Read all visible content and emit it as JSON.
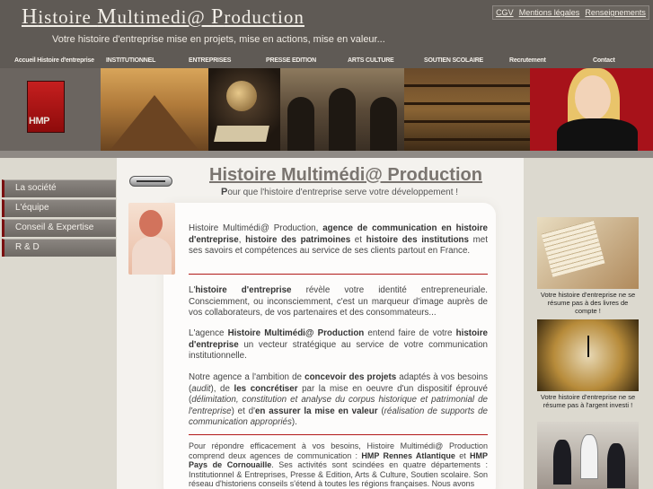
{
  "header": {
    "title_parts": [
      "H",
      "istoire ",
      "M",
      "ultimedi@ ",
      "P",
      "roduction"
    ],
    "tagline": "Votre histoire d'entreprise mise en projets, mise en actions, mise en valeur...",
    "links": [
      "CGV",
      "Mentions légales",
      "Renseignements"
    ]
  },
  "nav": {
    "items": [
      "Accueil Histoire d'entreprise",
      "INSTITUTIONNEL",
      "ENTREPRISES",
      "PRESSE EDITION",
      "ARTS CULTURE",
      "SOUTIEN SCOLAIRE",
      "Recrutement",
      "Contact"
    ]
  },
  "logo": {
    "text": "HMP"
  },
  "sidebar": {
    "items": [
      "La société",
      "L'équipe",
      "Conseil & Expertise",
      "R & D"
    ]
  },
  "main": {
    "title": "Histoire Multimédi@ Production",
    "subtitle_first": "P",
    "subtitle_rest": "our que l'histoire d'entreprise serve votre développement !",
    "p1": {
      "a": "Histoire Multimédi@ Production, ",
      "b": "agence de communication en histoire d'entreprise",
      "c": ", ",
      "d": "histoire des patrimoines",
      "e": " et ",
      "f": "histoire des institutions",
      "g": " met ses savoirs et compétences au service de ses clients partout en France."
    },
    "p2": {
      "a": "L'",
      "b": "histoire d'entreprise",
      "c": " révèle votre identité entrepreneuriale. Consciemment, ou inconsciemment, c'est un marqueur d'image auprès de vos collaborateurs, de vos partenaires et des consommateurs..."
    },
    "p3": {
      "a": "L'agence ",
      "b": "Histoire Multimédi@ Production",
      "c": " entend faire de votre ",
      "d": "histoire d'entreprise",
      "e": " un vecteur stratégique au service de votre communication institutionnelle."
    },
    "p4": {
      "a": "Notre agence a l'ambition de ",
      "b": "concevoir des projets",
      "c": " adaptés à vos besoins (",
      "d": "audit",
      "e": "), de ",
      "f": "les concrétiser",
      "g": " par la mise en oeuvre d'un dispositif éprouvé (",
      "h": "délimitation, constitution et analyse du corpus historique et patrimonial de l'entreprise",
      "i": ") et d'",
      "j": "en assurer la mise en valeur",
      "k": " (",
      "l": "réalisation de supports de communication appropriés",
      "m": ")."
    },
    "p5": {
      "a": "Pour répondre efficacement à vos besoins, Histoire Multimédi@ Production comprend deux agences de communication : ",
      "b": "HMP Rennes Atlantique",
      "c": " et ",
      "d": "HMP Pays de Cornouaille",
      "e": ". Ses activités sont scindées en quatre départements : Institutionnel & Entreprises, Presse & Edition, Arts & Culture, Soutien scolaire. Son réseau d'historiens conseils s'étend à toutes les régions françaises. Nous avons"
    }
  },
  "right": {
    "captions": [
      "Votre histoire d'entreprise ne se résume pas à des livres de compte !",
      "Votre histoire d'entreprise ne se résume pas à l'argent investi !"
    ]
  }
}
